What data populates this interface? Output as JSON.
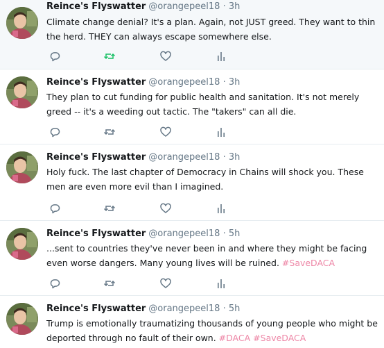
{
  "colors": {
    "text": "#14171a",
    "secondary": "#657786",
    "hashtag": "#e0245e",
    "retweet_active": "#17bf63",
    "divider": "#e6ecf0",
    "highlight_bg": "#f5f8fa"
  },
  "icons": [
    "reply-icon",
    "retweet-icon",
    "like-icon",
    "analytics-icon"
  ],
  "tweets": [
    {
      "name": "Reince's Flyswatter",
      "handle": "@orangepeel18",
      "dot": "·",
      "time": "3h",
      "text": "Climate change denial?  It's a plan.  Again, not JUST greed.   They want to thin the herd.  THEY can always escape somewhere else.",
      "hashtags": [],
      "retweeted": true
    },
    {
      "name": "Reince's Flyswatter",
      "handle": "@orangepeel18",
      "dot": "·",
      "time": "3h",
      "text": "They plan to cut funding for public health and sanitation.  It's not merely greed -- it's a weeding out tactic.  The \"takers\" can all die.",
      "hashtags": [],
      "retweeted": false
    },
    {
      "name": "Reince's Flyswatter",
      "handle": "@orangepeel18",
      "dot": "·",
      "time": "3h",
      "text": "Holy fuck.  The last chapter of Democracy in Chains will shock you.  These men are even more evil than I imagined.",
      "hashtags": [],
      "retweeted": false
    },
    {
      "name": "Reince's Flyswatter",
      "handle": "@orangepeel18",
      "dot": "·",
      "time": "5h",
      "text": "...sent to countries they've never been in and where they might be facing even worse dangers.  Many young lives will be ruined. ",
      "hashtags": [
        "#SaveDACA"
      ],
      "retweeted": false
    },
    {
      "name": "Reince's Flyswatter",
      "handle": "@orangepeel18",
      "dot": "·",
      "time": "5h",
      "text": "Trump is emotionally traumatizing thousands of young people who might be deported through no fault of their own. ",
      "hashtags": [
        "#DACA",
        "#SaveDACA"
      ],
      "retweeted": false
    }
  ]
}
